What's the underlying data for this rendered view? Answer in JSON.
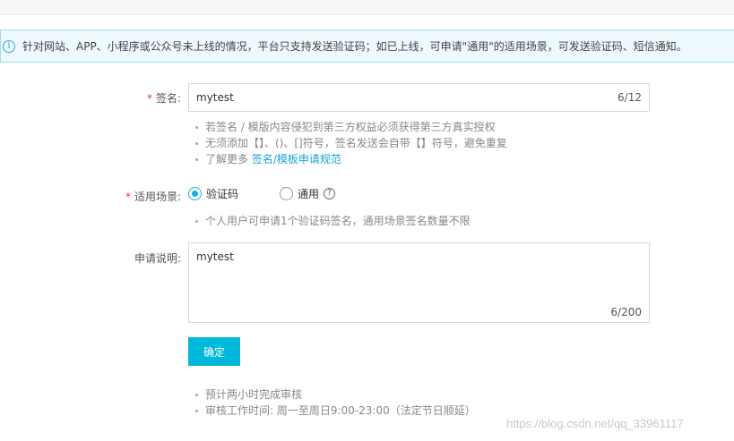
{
  "notice": {
    "icon": "info-icon",
    "text": "针对网站、APP、小程序或公众号未上线的情况，平台只支持发送验证码；如已上线，可申请\"通用\"的适用场景，可发送验证码、短信通知。"
  },
  "signature": {
    "label": "签名:",
    "value": "mytest",
    "counter": "6/12",
    "tips": [
      "若签名 / 模版内容侵犯到第三方权益必须获得第三方真实授权",
      "无须添加【】、()、[]符号，签名发送会自带【】符号，避免重复"
    ],
    "more_prefix": "了解更多 ",
    "more_link": "签名/模板申请规范"
  },
  "scene": {
    "label": "适用场景:",
    "options": [
      {
        "label": "验证码",
        "selected": true
      },
      {
        "label": "通用",
        "selected": false
      }
    ],
    "help_icon": "question-icon",
    "tip": "个人用户可申请1个验证码签名，通用场景签名数量不限"
  },
  "description": {
    "label": "申请说明:",
    "value": "mytest",
    "counter": "6/200"
  },
  "confirm_label": "确定",
  "bottom_tips": [
    "预计两小时完成审核",
    "审核工作时间: 周一至周日9:00-23:00（法定节日顺延）"
  ],
  "watermark": "https://blog.csdn.net/qq_33961117",
  "colors": {
    "accent": "#00b8d9",
    "required": "#e4393c",
    "link": "#1aa5d8",
    "notice_bg": "#eef9fd",
    "notice_border": "#9fddf0"
  }
}
